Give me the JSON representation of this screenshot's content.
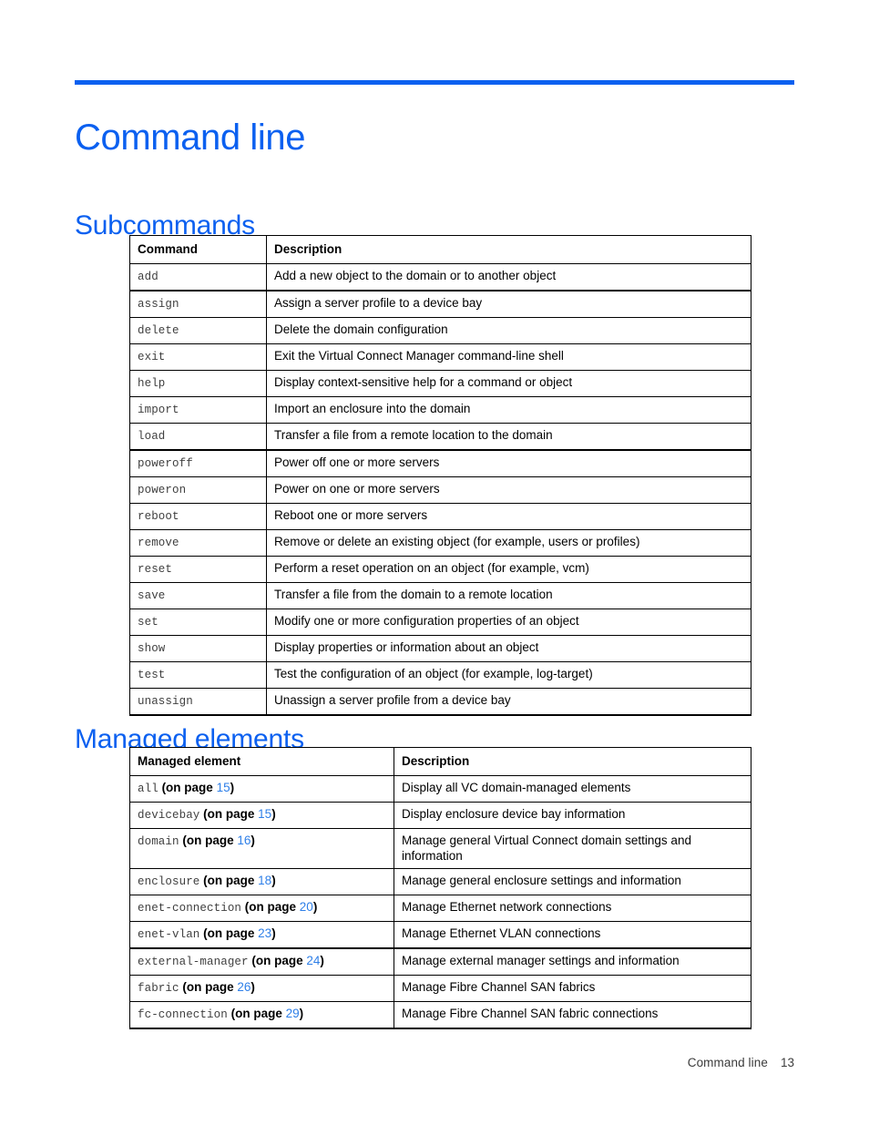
{
  "document": {
    "chapter_title": "Command line",
    "accent_color": "#0B60F0",
    "link_color": "#2E7FE8"
  },
  "sections": {
    "subcommands": {
      "heading": "Subcommands",
      "table": {
        "headers": [
          "Command",
          "Description"
        ],
        "rows": [
          {
            "command": "add",
            "description": "Add a new object to the domain or to another object"
          },
          {
            "command": "assign",
            "description": "Assign a server profile to a device bay"
          },
          {
            "command": "delete",
            "description": "Delete the domain configuration"
          },
          {
            "command": "exit",
            "description": "Exit the Virtual Connect Manager command-line shell"
          },
          {
            "command": "help",
            "description": "Display context-sensitive help for a command or object"
          },
          {
            "command": "import",
            "description": "Import an enclosure into the domain"
          },
          {
            "command": "load",
            "description": "Transfer a file from a remote location to the domain"
          },
          {
            "command": "poweroff",
            "description": "Power off one or more servers"
          },
          {
            "command": "poweron",
            "description": "Power on one or more servers"
          },
          {
            "command": "reboot",
            "description": "Reboot one or more servers"
          },
          {
            "command": "remove",
            "description": "Remove or delete an existing object (for example, users or profiles)"
          },
          {
            "command": "reset",
            "description": "Perform a reset operation on an object (for example, vcm)"
          },
          {
            "command": "save",
            "description": "Transfer a file from the domain to a remote location"
          },
          {
            "command": "set",
            "description": "Modify one or more configuration properties of an object"
          },
          {
            "command": "show",
            "description": "Display properties or information about an object"
          },
          {
            "command": "test",
            "description": "Test the configuration of an object (for example, log-target)"
          },
          {
            "command": "unassign",
            "description": "Unassign a server profile from a device bay"
          }
        ]
      }
    },
    "managed_elements": {
      "heading": "Managed elements",
      "table": {
        "headers": [
          "Managed element",
          "Description"
        ],
        "rows": [
          {
            "element": "all",
            "ref_prefix": " (on page ",
            "page": "15",
            "ref_suffix": ")",
            "description": "Display all VC domain-managed elements"
          },
          {
            "element": "devicebay",
            "ref_prefix": " (on page ",
            "page": "15",
            "ref_suffix": ")",
            "description": "Display enclosure device bay information"
          },
          {
            "element": "domain",
            "ref_prefix": " (on page ",
            "page": "16",
            "ref_suffix": ")",
            "description": "Manage general Virtual Connect domain settings and information"
          },
          {
            "element": "enclosure",
            "ref_prefix": " (on page ",
            "page": "18",
            "ref_suffix": ")",
            "description": "Manage general enclosure settings and information"
          },
          {
            "element": "enet-connection",
            "ref_prefix": " (on page ",
            "page": "20",
            "ref_suffix": ")",
            "description": "Manage Ethernet network connections"
          },
          {
            "element": "enet-vlan",
            "ref_prefix": " (on page ",
            "page": "23",
            "ref_suffix": ")",
            "description": "Manage Ethernet VLAN connections"
          },
          {
            "element": "external-manager",
            "ref_prefix": " (on page ",
            "page": "24",
            "ref_suffix": ")",
            "description": "Manage external manager settings and information"
          },
          {
            "element": "fabric",
            "ref_prefix": " (on page ",
            "page": "26",
            "ref_suffix": ")",
            "description": "Manage Fibre Channel SAN fabrics"
          },
          {
            "element": "fc-connection",
            "ref_prefix": " (on page ",
            "page": "29",
            "ref_suffix": ")",
            "description": "Manage Fibre Channel SAN fabric connections"
          }
        ]
      }
    }
  },
  "footer": {
    "label": "Command line",
    "page_number": "13"
  }
}
